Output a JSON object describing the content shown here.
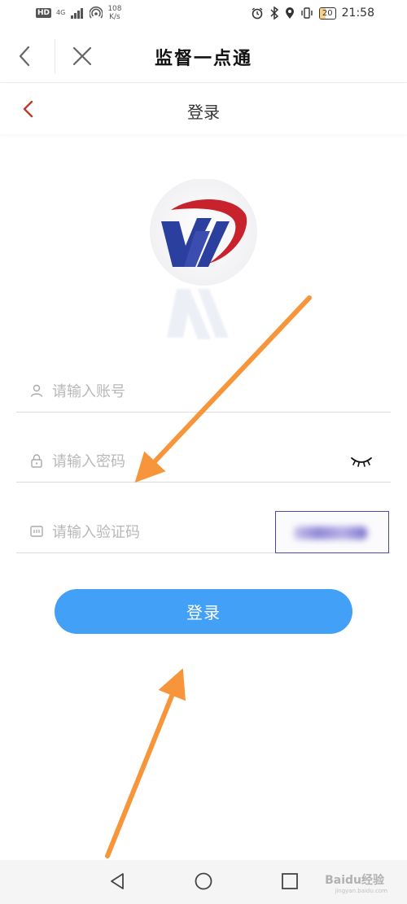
{
  "status_bar": {
    "hd_badge": "HD",
    "network": "4G",
    "speed_value": "108",
    "speed_unit": "K/s",
    "battery": "20",
    "time": "21:58"
  },
  "header": {
    "title": "监督一点通"
  },
  "page": {
    "title": "登录"
  },
  "form": {
    "account_placeholder": "请输入账号",
    "account_value": "",
    "password_placeholder": "请输入密码",
    "password_value": "",
    "captcha_placeholder": "请输入验证码",
    "captcha_value": ""
  },
  "login_button": "登录",
  "watermark": {
    "text": "Baidu经验",
    "sub": "jingyan.baidu.com"
  },
  "colors": {
    "primary_button": "#42a0f7",
    "back_arrow_red": "#c0392b",
    "annotation_arrow": "#f7953a",
    "logo_red": "#c8232c",
    "logo_blue": "#2b3f9e"
  },
  "icons": {
    "header_back": "chevron-left-icon",
    "header_close": "close-icon",
    "page_back": "chevron-left-icon",
    "account": "user-icon",
    "password": "lock-icon",
    "captcha": "code-icon",
    "show_password": "eye-closed-icon",
    "nav_back": "triangle-back-icon",
    "nav_home": "circle-home-icon",
    "nav_recent": "square-recent-icon"
  }
}
